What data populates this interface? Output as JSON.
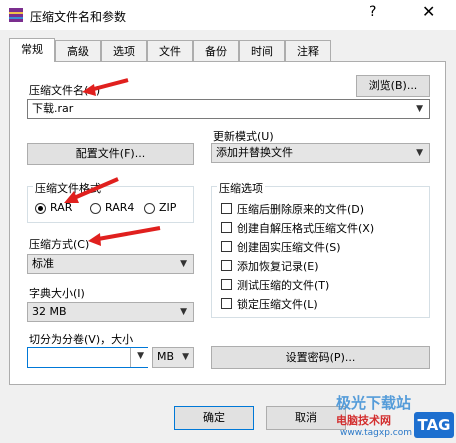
{
  "window": {
    "title": "压缩文件名和参数",
    "help": "?",
    "close": "✕"
  },
  "tabs": [
    {
      "label": "常规"
    },
    {
      "label": "高级"
    },
    {
      "label": "选项"
    },
    {
      "label": "文件"
    },
    {
      "label": "备份"
    },
    {
      "label": "时间"
    },
    {
      "label": "注释"
    }
  ],
  "archive": {
    "name_label": "压缩文件名(A)",
    "browse_label": "浏览(B)...",
    "name_value": "下载.rar"
  },
  "update_mode": {
    "label": "更新模式(U)",
    "value": "添加并替换文件"
  },
  "profiles_button": "配置文件(F)...",
  "format": {
    "label": "压缩文件格式",
    "options": [
      "RAR",
      "RAR4",
      "ZIP"
    ],
    "selected": "RAR"
  },
  "method": {
    "label": "压缩方式(C)",
    "value": "标准"
  },
  "dictionary": {
    "label": "字典大小(I)",
    "value": "32 MB"
  },
  "split": {
    "label": "切分为分卷(V)，大小",
    "value": "",
    "unit": "MB"
  },
  "options": {
    "label": "压缩选项",
    "items": [
      "压缩后删除原来的文件(D)",
      "创建自解压格式压缩文件(X)",
      "创建固实压缩文件(S)",
      "添加恢复记录(E)",
      "测试压缩的文件(T)",
      "锁定压缩文件(L)"
    ]
  },
  "password_button": "设置密码(P)...",
  "footer": {
    "ok": "确定",
    "cancel": "取消"
  },
  "watermark": {
    "line1": "极光下载站",
    "line2": "电脑技术网",
    "url": "www.tagxp.com",
    "tag": "TAG"
  },
  "colors": {
    "arrow": "#e0201e",
    "selection": "#cce8ff"
  }
}
